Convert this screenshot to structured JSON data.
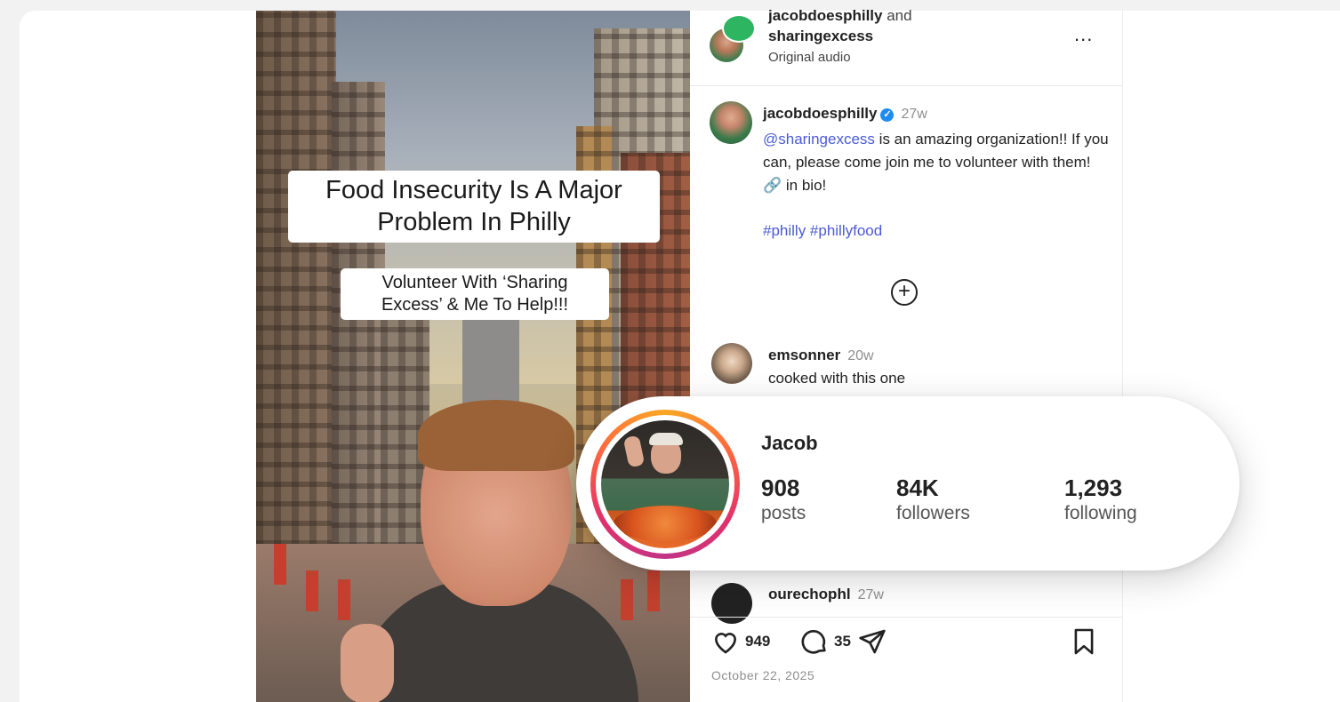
{
  "video": {
    "caption_main": "Food Insecurity Is A Major Problem In Philly",
    "caption_sub": "Volunteer With ‘Sharing Excess’ & Me To Help!!!"
  },
  "post_header": {
    "user1": "jacobdoesphilly",
    "and_text": "and",
    "user2": "sharingexcess",
    "audio": "Original audio",
    "more": "..."
  },
  "caption": {
    "username": "jacobdoesphilly",
    "verified_mark": "✓",
    "time": "27w",
    "mention": "@sharingexcess",
    "text": " is an amazing organization!! If you can, please come join me to volunteer with them! 🔗 in bio!",
    "hashtags": "#philly #phillyfood"
  },
  "load_more": "+",
  "comments": [
    {
      "username": "emsonner",
      "time": "20w",
      "text": "cooked with this one"
    },
    {
      "username": "ourechophl",
      "time": "27w",
      "text": ""
    }
  ],
  "actions": {
    "likes": "949",
    "comments": "35"
  },
  "date": "October 22, 2025",
  "profile": {
    "name": "Jacob",
    "stats": [
      {
        "value": "908",
        "label": "posts"
      },
      {
        "value": "84K",
        "label": "followers"
      },
      {
        "value": "1,293",
        "label": "following"
      }
    ]
  },
  "colors": {
    "link": "#4a5bd6",
    "verified": "#1d8cf0",
    "story_ring": "#e1306c"
  },
  "icons": [
    "more-icon",
    "verified-icon",
    "plus-circle-icon",
    "heart-icon",
    "comment-icon",
    "share-icon",
    "bookmark-icon"
  ]
}
